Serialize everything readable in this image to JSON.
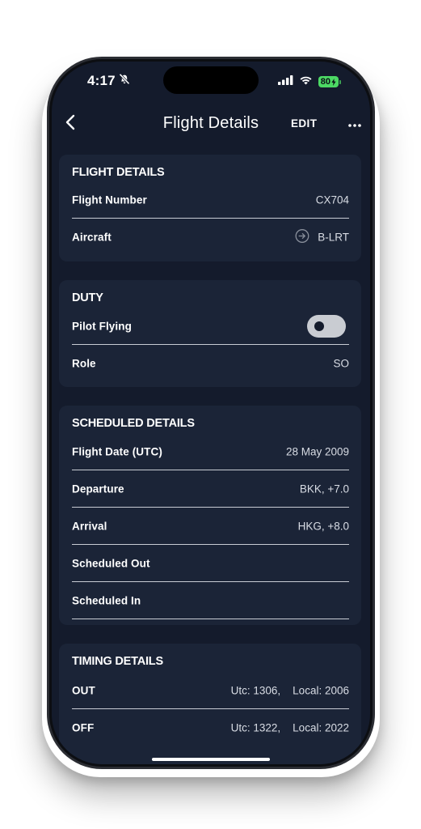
{
  "status_bar": {
    "time": "4:17",
    "battery": "80"
  },
  "nav": {
    "title": "Flight Details",
    "edit_label": "EDIT"
  },
  "sections": {
    "flight_details": {
      "title": "FLIGHT DETAILS",
      "rows": [
        {
          "label": "Flight Number",
          "value": "CX704"
        },
        {
          "label": "Aircraft",
          "value": "B-LRT"
        }
      ]
    },
    "duty": {
      "title": "DUTY",
      "rows": [
        {
          "label": "Pilot Flying",
          "toggle": false
        },
        {
          "label": "Role",
          "value": "SO"
        }
      ]
    },
    "scheduled_details": {
      "title": "SCHEDULED DETAILS",
      "rows": [
        {
          "label": "Flight Date (UTC)",
          "value": "28 May 2009"
        },
        {
          "label": "Departure",
          "value": "BKK, +7.0"
        },
        {
          "label": "Arrival",
          "value": "HKG, +8.0"
        },
        {
          "label": "Scheduled Out",
          "value": ""
        },
        {
          "label": "Scheduled In",
          "value": ""
        }
      ]
    },
    "timing_details": {
      "title": "TIMING DETAILS",
      "rows": [
        {
          "label": "OUT",
          "value": "Utc: 1306,    Local: 2006"
        },
        {
          "label": "OFF",
          "value": "Utc: 1322,    Local: 2022"
        }
      ]
    }
  },
  "colors": {
    "screen_bg": "#141b2c",
    "card_bg": "#1b2437",
    "battery": "#4cd964"
  },
  "icons": {
    "back": "chevron-left-icon",
    "more": "ellipsis-icon",
    "aircraft_link": "arrow-circle-right-icon",
    "bell_slash": "bell-slash-icon"
  }
}
